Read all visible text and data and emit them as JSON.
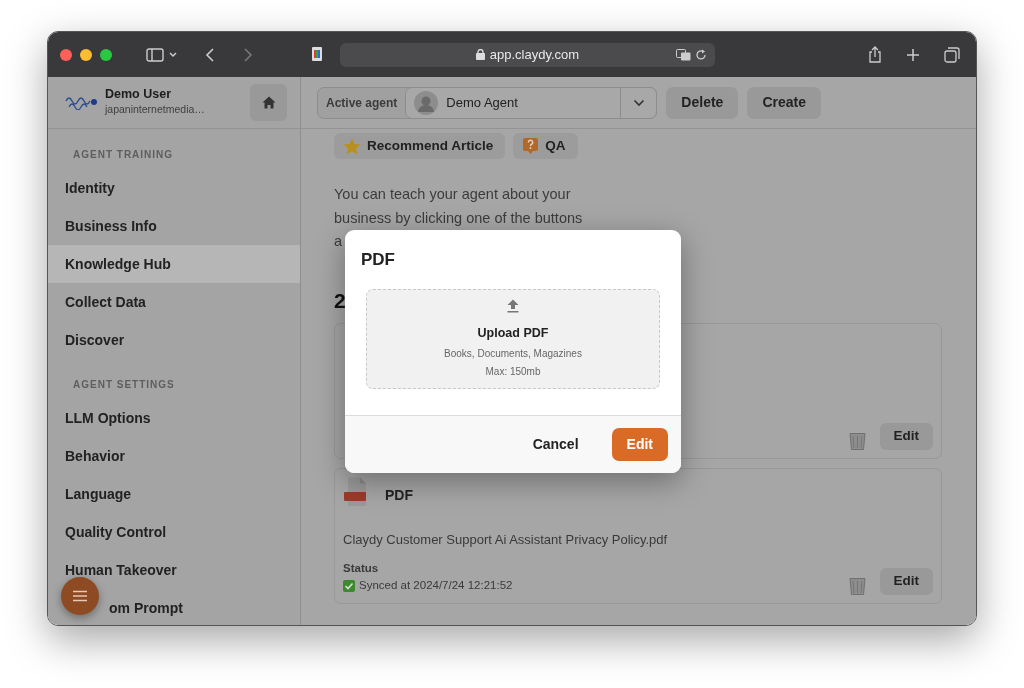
{
  "browser": {
    "url": "app.claydy.com"
  },
  "sidebar": {
    "user": {
      "name": "Demo User",
      "email": "japaninternetmedia…"
    },
    "sections": [
      {
        "title": "AGENT TRAINING",
        "items": [
          {
            "label": "Identity",
            "selected": false
          },
          {
            "label": "Business Info",
            "selected": false
          },
          {
            "label": "Knowledge Hub",
            "selected": true
          },
          {
            "label": "Collect Data",
            "selected": false
          },
          {
            "label": "Discover",
            "selected": false
          }
        ]
      },
      {
        "title": "AGENT SETTINGS",
        "items": [
          {
            "label": "LLM Options",
            "selected": false
          },
          {
            "label": "Behavior",
            "selected": false
          },
          {
            "label": "Language",
            "selected": false
          },
          {
            "label": "Quality Control",
            "selected": false
          },
          {
            "label": "Human Takeover",
            "selected": false
          },
          {
            "label": "om Prompt",
            "selected": false
          }
        ]
      }
    ]
  },
  "header": {
    "agent_label": "Active agent",
    "agent_name": "Demo Agent",
    "buttons": [
      "Delete",
      "Create"
    ]
  },
  "content": {
    "actions": [
      {
        "label": "Recommend Article",
        "kind": "star"
      },
      {
        "label": "QA",
        "kind": "qa"
      }
    ],
    "intro": "You can teach your agent about your business by clicking one of the buttons a",
    "heading": "2",
    "cards": [
      {
        "edit_label": "Edit"
      },
      {
        "type_label": "PDF",
        "filename": "Claydy Customer Support Ai Assistant Privacy Policy.pdf",
        "status_label": "Status",
        "status": "Synced at 2024/7/24 12:21:52",
        "edit_label": "Edit"
      }
    ]
  },
  "modal": {
    "title": "PDF",
    "upload_title": "Upload PDF",
    "upload_hint": "Books, Documents, Magazines",
    "upload_max": "Max: 150mb",
    "buttons": [
      {
        "label": "Cancel",
        "kind": "plain"
      },
      {
        "label": "Edit",
        "kind": "primary"
      }
    ]
  }
}
